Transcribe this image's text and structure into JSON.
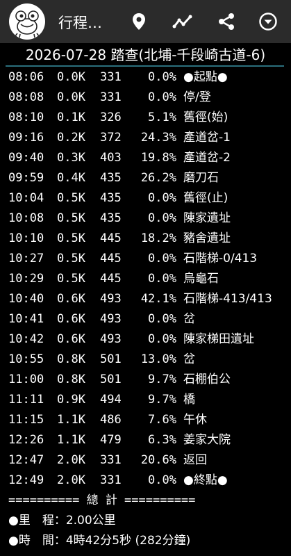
{
  "app_bar": {
    "title": "行程…",
    "avatar_icon": "frog-logo-icon",
    "actions": [
      "location-pin-icon",
      "trend-line-icon",
      "share-icon",
      "more-dropdown-icon"
    ]
  },
  "trip": {
    "title": "2026-07-28 踏查(北埔-千段崎古道-6)"
  },
  "rows": [
    {
      "time": "08:06",
      "dist": "0.0K",
      "elev": "331",
      "grade": "0.0%",
      "place": "●起點●"
    },
    {
      "time": "08:08",
      "dist": "0.0K",
      "elev": "331",
      "grade": "0.0%",
      "place": "停/登"
    },
    {
      "time": "08:10",
      "dist": "0.1K",
      "elev": "326",
      "grade": "5.1%",
      "place": "舊徑(始)"
    },
    {
      "time": "09:16",
      "dist": "0.2K",
      "elev": "372",
      "grade": "24.3%",
      "place": "產道岔-1"
    },
    {
      "time": "09:40",
      "dist": "0.3K",
      "elev": "403",
      "grade": "19.8%",
      "place": "產道岔-2"
    },
    {
      "time": "09:59",
      "dist": "0.4K",
      "elev": "435",
      "grade": "26.2%",
      "place": "磨刀石"
    },
    {
      "time": "10:04",
      "dist": "0.5K",
      "elev": "435",
      "grade": "0.0%",
      "place": "舊徑(止)"
    },
    {
      "time": "10:08",
      "dist": "0.5K",
      "elev": "435",
      "grade": "0.0%",
      "place": "陳家遺址"
    },
    {
      "time": "10:10",
      "dist": "0.5K",
      "elev": "445",
      "grade": "18.2%",
      "place": "豬舍遺址"
    },
    {
      "time": "10:27",
      "dist": "0.5K",
      "elev": "445",
      "grade": "0.0%",
      "place": "石階梯-0/413"
    },
    {
      "time": "10:29",
      "dist": "0.5K",
      "elev": "445",
      "grade": "0.0%",
      "place": "烏龜石"
    },
    {
      "time": "10:40",
      "dist": "0.6K",
      "elev": "493",
      "grade": "42.1%",
      "place": "石階梯-413/413"
    },
    {
      "time": "10:41",
      "dist": "0.6K",
      "elev": "493",
      "grade": "0.0%",
      "place": "岔"
    },
    {
      "time": "10:42",
      "dist": "0.6K",
      "elev": "493",
      "grade": "0.0%",
      "place": "陳家梯田遺址"
    },
    {
      "time": "10:55",
      "dist": "0.8K",
      "elev": "501",
      "grade": "13.0%",
      "place": "岔"
    },
    {
      "time": "11:00",
      "dist": "0.8K",
      "elev": "501",
      "grade": "9.7%",
      "place": "石棚伯公"
    },
    {
      "time": "11:11",
      "dist": "0.9K",
      "elev": "494",
      "grade": "9.7%",
      "place": "橋"
    },
    {
      "time": "11:15",
      "dist": "1.1K",
      "elev": "486",
      "grade": "7.6%",
      "place": "午休"
    },
    {
      "time": "12:26",
      "dist": "1.1K",
      "elev": "479",
      "grade": "6.3%",
      "place": "姜家大院"
    },
    {
      "time": "12:47",
      "dist": "2.0K",
      "elev": "331",
      "grade": "20.6%",
      "place": "返回"
    },
    {
      "time": "12:49",
      "dist": "2.0K",
      "elev": "331",
      "grade": "0.0%",
      "place": "●終點●"
    }
  ],
  "summary": {
    "separator": "========== 總 計 ==========",
    "distance": "●里　程：2.00公里",
    "duration": "●時　間：4時42分5秒 (282分鐘)"
  },
  "colors": {
    "app_bar": "#2b2b2b",
    "background": "#000000",
    "accent_rule": "#2b6f7d"
  }
}
